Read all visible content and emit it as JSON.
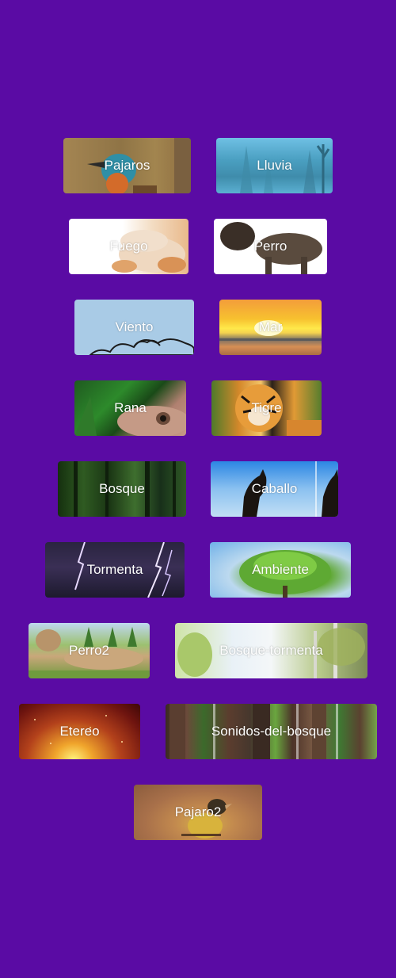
{
  "colors": {
    "background": "#5a0ba4",
    "label": "#ffffff"
  },
  "sounds": [
    {
      "label": "Pajaros"
    },
    {
      "label": "Lluvia"
    },
    {
      "label": "Fuego"
    },
    {
      "label": "Perro"
    },
    {
      "label": "Viento"
    },
    {
      "label": "Mar"
    },
    {
      "label": "Rana"
    },
    {
      "label": "Tigre"
    },
    {
      "label": "Bosque"
    },
    {
      "label": "Caballo"
    },
    {
      "label": "Tormenta"
    },
    {
      "label": "Ambiente"
    },
    {
      "label": "Perro2"
    },
    {
      "label": "Bosque-tormenta"
    },
    {
      "label": "Etereo"
    },
    {
      "label": "Sonidos-del-bosque"
    },
    {
      "label": "Pajaro2"
    }
  ]
}
